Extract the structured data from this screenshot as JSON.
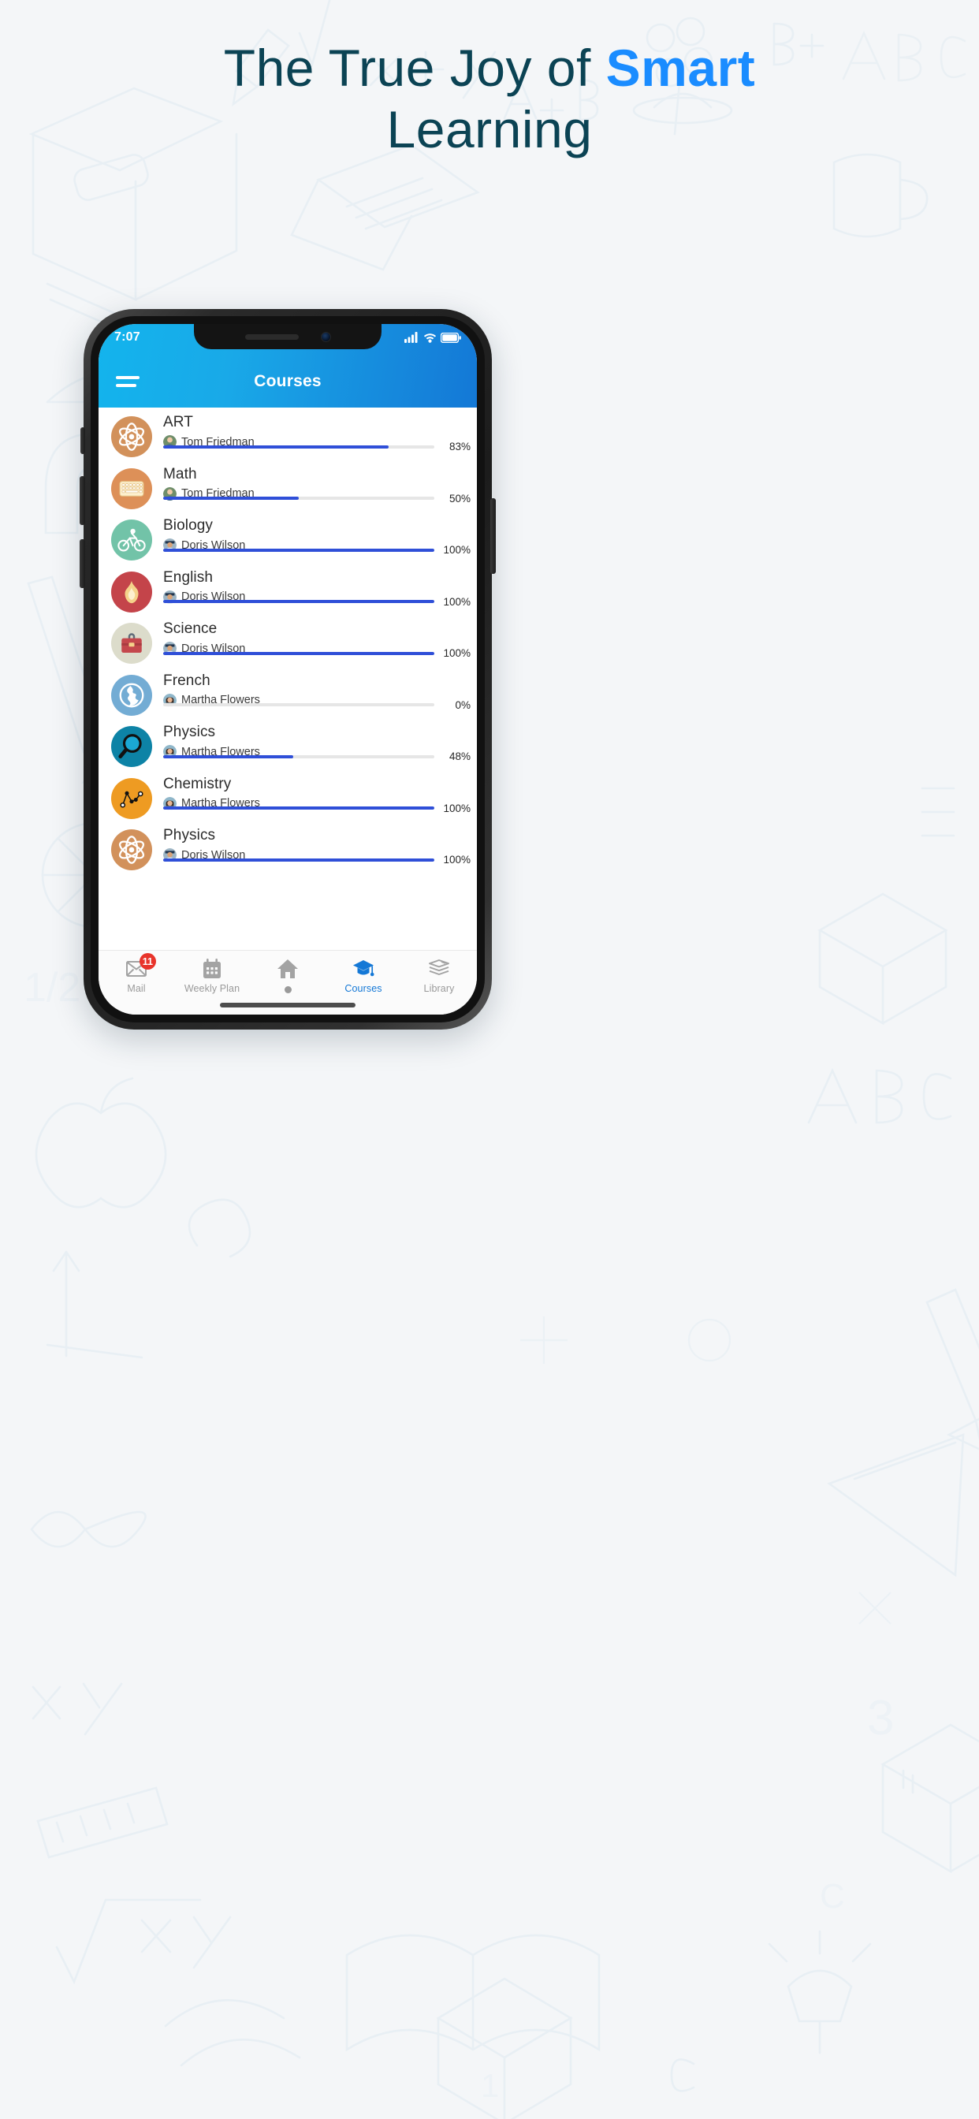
{
  "promo": {
    "headline_prefix": "The True Joy of ",
    "headline_accent": "Smart",
    "headline_line2": "Learning",
    "accent_color": "#1a8cff",
    "text_color": "#0b4354",
    "background_color": "#f4f6f8"
  },
  "status_bar": {
    "time": "7:07",
    "icons": [
      "cellular-signal-icon",
      "wifi-icon",
      "battery-icon"
    ]
  },
  "app_bar": {
    "title": "Courses",
    "menu_icon": "hamburger-menu-icon",
    "gradient_from": "#13b4ed",
    "gradient_to": "#1478d6"
  },
  "courses": [
    {
      "name": "ART",
      "teacher": "Tom Friedman",
      "progress": 83,
      "progress_label": "83%",
      "icon": "atom-icon",
      "icon_bg": "#d2915b"
    },
    {
      "name": "Math",
      "teacher": "Tom Friedman",
      "progress": 50,
      "progress_label": "50%",
      "icon": "keyboard-icon",
      "icon_bg": "#dd9058"
    },
    {
      "name": "Biology",
      "teacher": "Doris Wilson",
      "progress": 100,
      "progress_label": "100%",
      "icon": "cyclist-icon",
      "icon_bg": "#72c3a8"
    },
    {
      "name": "English",
      "teacher": "Doris Wilson",
      "progress": 100,
      "progress_label": "100%",
      "icon": "flame-icon",
      "icon_bg": "#c4444a"
    },
    {
      "name": "Science",
      "teacher": "Doris Wilson",
      "progress": 100,
      "progress_label": "100%",
      "icon": "briefcase-icon",
      "icon_bg": "#dcdccb"
    },
    {
      "name": "French",
      "teacher": "Martha Flowers",
      "progress": 0,
      "progress_label": "0%",
      "icon": "globe-icon",
      "icon_bg": "#73acd4"
    },
    {
      "name": "Physics",
      "teacher": "Martha Flowers",
      "progress": 48,
      "progress_label": "48%",
      "icon": "magnifier-icon",
      "icon_bg": "#0d83a6"
    },
    {
      "name": "Chemistry",
      "teacher": "Martha Flowers",
      "progress": 100,
      "progress_label": "100%",
      "icon": "line-chart-icon",
      "icon_bg": "#ee9b22"
    },
    {
      "name": "Physics",
      "teacher": "Doris Wilson",
      "progress": 100,
      "progress_label": "100%",
      "icon": "atom-icon",
      "icon_bg": "#d2915b"
    }
  ],
  "progress_colors": {
    "fill": "#2f4fd8",
    "track": "#e6e6e6"
  },
  "tabs": [
    {
      "label": "Mail",
      "icon": "envelope-icon",
      "badge": "11",
      "active": false
    },
    {
      "label": "Weekly Plan",
      "icon": "calendar-icon",
      "badge": null,
      "active": false
    },
    {
      "label": "",
      "icon": "home-icon",
      "badge": null,
      "active": false
    },
    {
      "label": "Courses",
      "icon": "graduation-cap-icon",
      "badge": null,
      "active": true
    },
    {
      "label": "Library",
      "icon": "books-stack-icon",
      "badge": null,
      "active": false
    }
  ]
}
